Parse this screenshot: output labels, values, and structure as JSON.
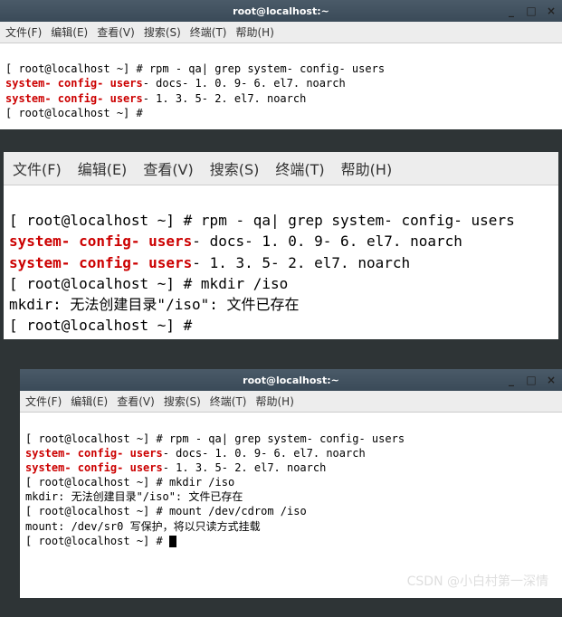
{
  "titlebar": {
    "title": "root@localhost:~",
    "min": "_",
    "max": "□",
    "close": "×"
  },
  "menus": {
    "file": "文件(F)",
    "edit": "编辑(E)",
    "view": "查看(V)",
    "search": "搜索(S)",
    "terminal": "终端(T)",
    "help": "帮助(H)"
  },
  "term1": {
    "l1_prompt": "[ root@localhost ~] # ",
    "l1_cmd": "rpm - qa| grep system- config- users",
    "l2_hl": "system- config- users",
    "l2_rest": "- docs- 1. 0. 9- 6. el7. noarch",
    "l3_hl": "system- config- users",
    "l3_rest": "- 1. 3. 5- 2. el7. noarch",
    "l4_prompt": "[ root@localhost ~] #"
  },
  "term2": {
    "l1_prompt": "[ root@localhost ~] # ",
    "l1_cmd": "rpm - qa| grep system- config- users",
    "l2_hl": "system- config- users",
    "l2_rest": "- docs- 1. 0. 9- 6. el7. noarch",
    "l3_hl": "system- config- users",
    "l3_rest": "- 1. 3. 5- 2. el7. noarch",
    "l4_prompt": "[ root@localhost ~] # ",
    "l4_cmd": "mkdir /iso",
    "l5": "mkdir: 无法创建目录\"/iso\": 文件已存在",
    "l6_prompt": "[ root@localhost ~] #"
  },
  "term3": {
    "l1_prompt": "[ root@localhost ~] # ",
    "l1_cmd": "rpm - qa| grep system- config- users",
    "l2_hl": "system- config- users",
    "l2_rest": "- docs- 1. 0. 9- 6. el7. noarch",
    "l3_hl": "system- config- users",
    "l3_rest": "- 1. 3. 5- 2. el7. noarch",
    "l4_prompt": "[ root@localhost ~] # ",
    "l4_cmd": "mkdir /iso",
    "l5": "mkdir: 无法创建目录\"/iso\": 文件已存在",
    "l6_prompt": "[ root@localhost ~] # ",
    "l6_cmd": "mount /dev/cdrom /iso",
    "l7": "mount: /dev/sr0 写保护，将以只读方式挂载",
    "l8_prompt": "[ root@localhost ~] # "
  },
  "watermark": "CSDN @小白村第一深情"
}
